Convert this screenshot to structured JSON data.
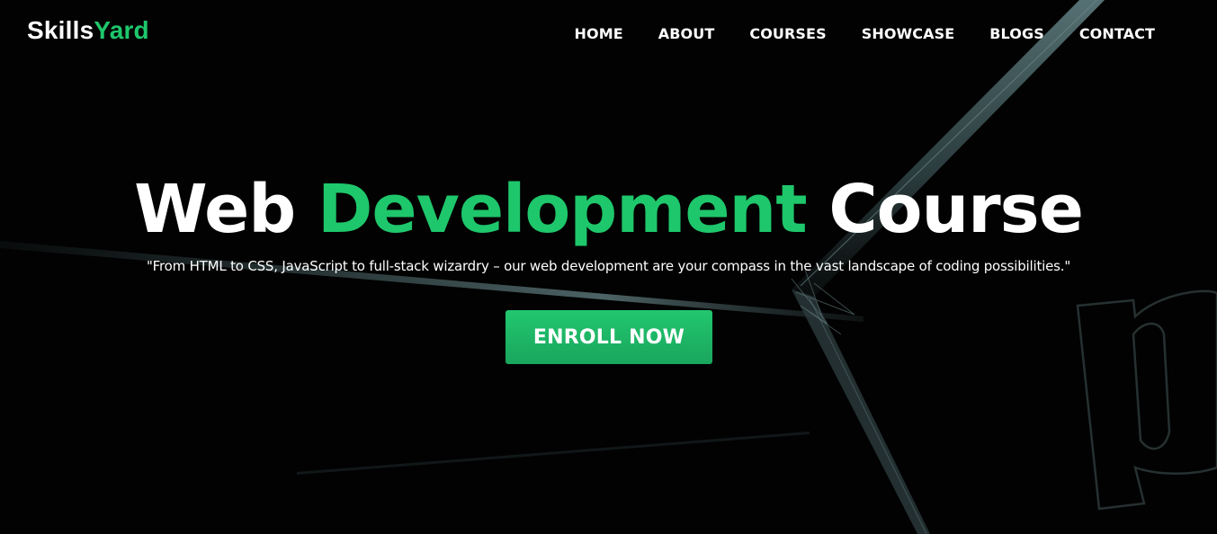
{
  "brand": {
    "name_primary": "Skills",
    "name_accent": "Yard",
    "accent_color": "#1ec76b"
  },
  "nav": {
    "items": [
      {
        "label": "HOME"
      },
      {
        "label": "ABOUT"
      },
      {
        "label": "COURSES"
      },
      {
        "label": "SHOWCASE"
      },
      {
        "label": "BLOGS"
      },
      {
        "label": "CONTACT"
      }
    ]
  },
  "hero": {
    "title_part1": "Web",
    "title_accent": "Development",
    "title_part2": "Course",
    "tagline": "\"From HTML to CSS, JavaScript to full-stack wizardry – our web development are your compass in the vast landscape of coding possibilities.\"",
    "cta_label": "ENROLL NOW",
    "cta_color": "#22c76f",
    "background_color": "#020202"
  }
}
